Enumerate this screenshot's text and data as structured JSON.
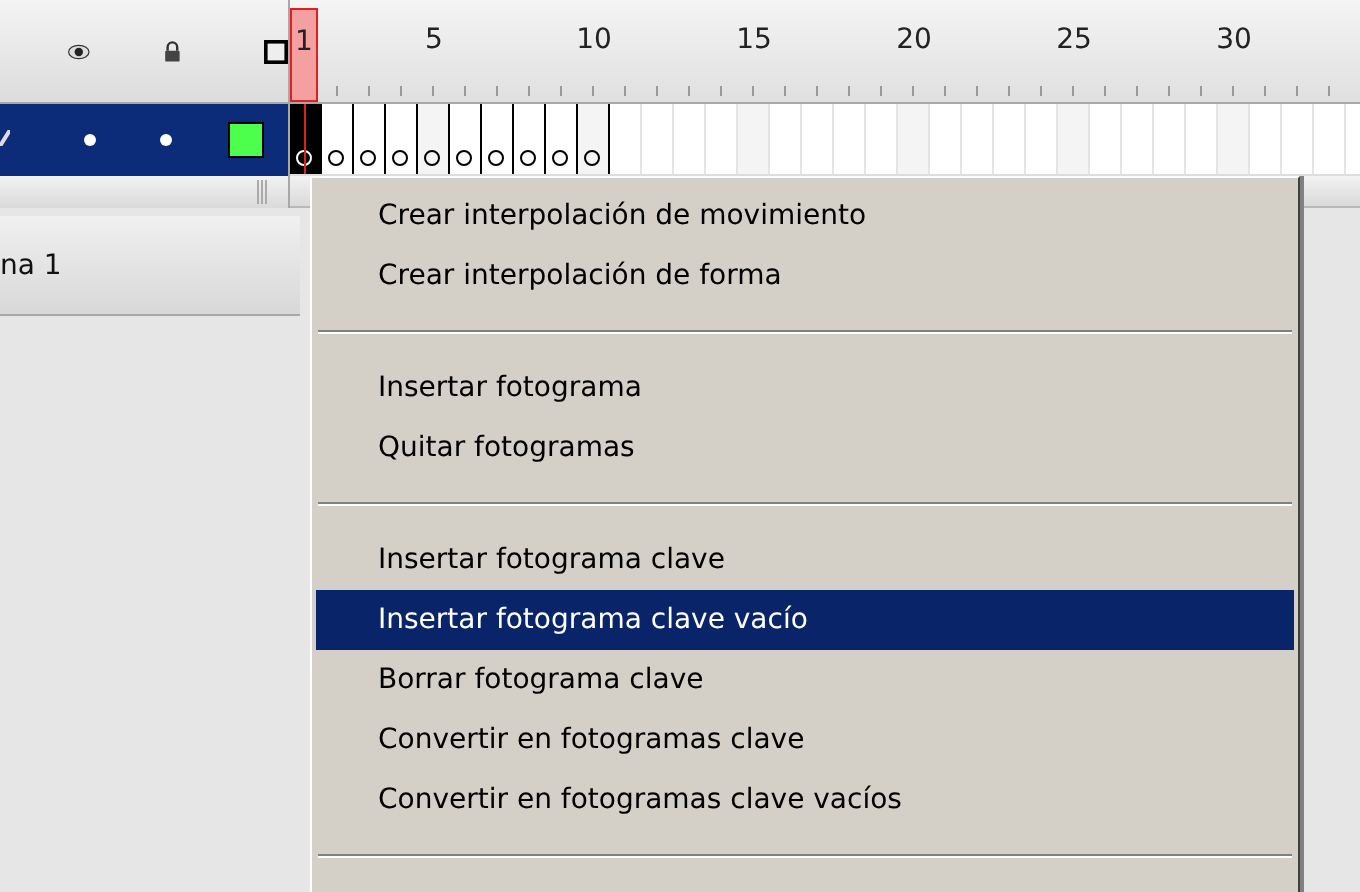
{
  "ruler": {
    "labels": [
      "1",
      "5",
      "10",
      "15",
      "20",
      "25",
      "30"
    ]
  },
  "layers": [
    {
      "selected": true,
      "color": "#4cff4c",
      "frames": [
        {
          "kind": "empty_keyframe",
          "selected": true
        },
        {
          "kind": "empty_keyframe",
          "selected": false
        },
        {
          "kind": "empty_keyframe",
          "selected": false
        },
        {
          "kind": "empty_keyframe",
          "selected": false
        },
        {
          "kind": "empty_keyframe",
          "selected": false
        },
        {
          "kind": "empty_keyframe",
          "selected": false
        },
        {
          "kind": "empty_keyframe",
          "selected": false
        },
        {
          "kind": "empty_keyframe",
          "selected": false
        },
        {
          "kind": "empty_keyframe",
          "selected": false
        },
        {
          "kind": "empty_keyframe",
          "selected": false
        }
      ]
    }
  ],
  "scene_tab": {
    "label": "na 1"
  },
  "context_menu": {
    "items": [
      {
        "kind": "item",
        "label": "Crear interpolación de movimiento",
        "selected": false
      },
      {
        "kind": "item",
        "label": "Crear interpolación de forma",
        "selected": false
      },
      {
        "kind": "separator"
      },
      {
        "kind": "item",
        "label": "Insertar fotograma",
        "selected": false
      },
      {
        "kind": "item",
        "label": "Quitar fotogramas",
        "selected": false
      },
      {
        "kind": "separator"
      },
      {
        "kind": "item",
        "label": "Insertar fotograma clave",
        "selected": false
      },
      {
        "kind": "item",
        "label": "Insertar fotograma clave vacío",
        "selected": true
      },
      {
        "kind": "item",
        "label": "Borrar fotograma clave",
        "selected": false
      },
      {
        "kind": "item",
        "label": "Convertir en fotogramas clave",
        "selected": false
      },
      {
        "kind": "item",
        "label": "Convertir en fotogramas clave vacíos",
        "selected": false
      },
      {
        "kind": "separator"
      }
    ]
  }
}
